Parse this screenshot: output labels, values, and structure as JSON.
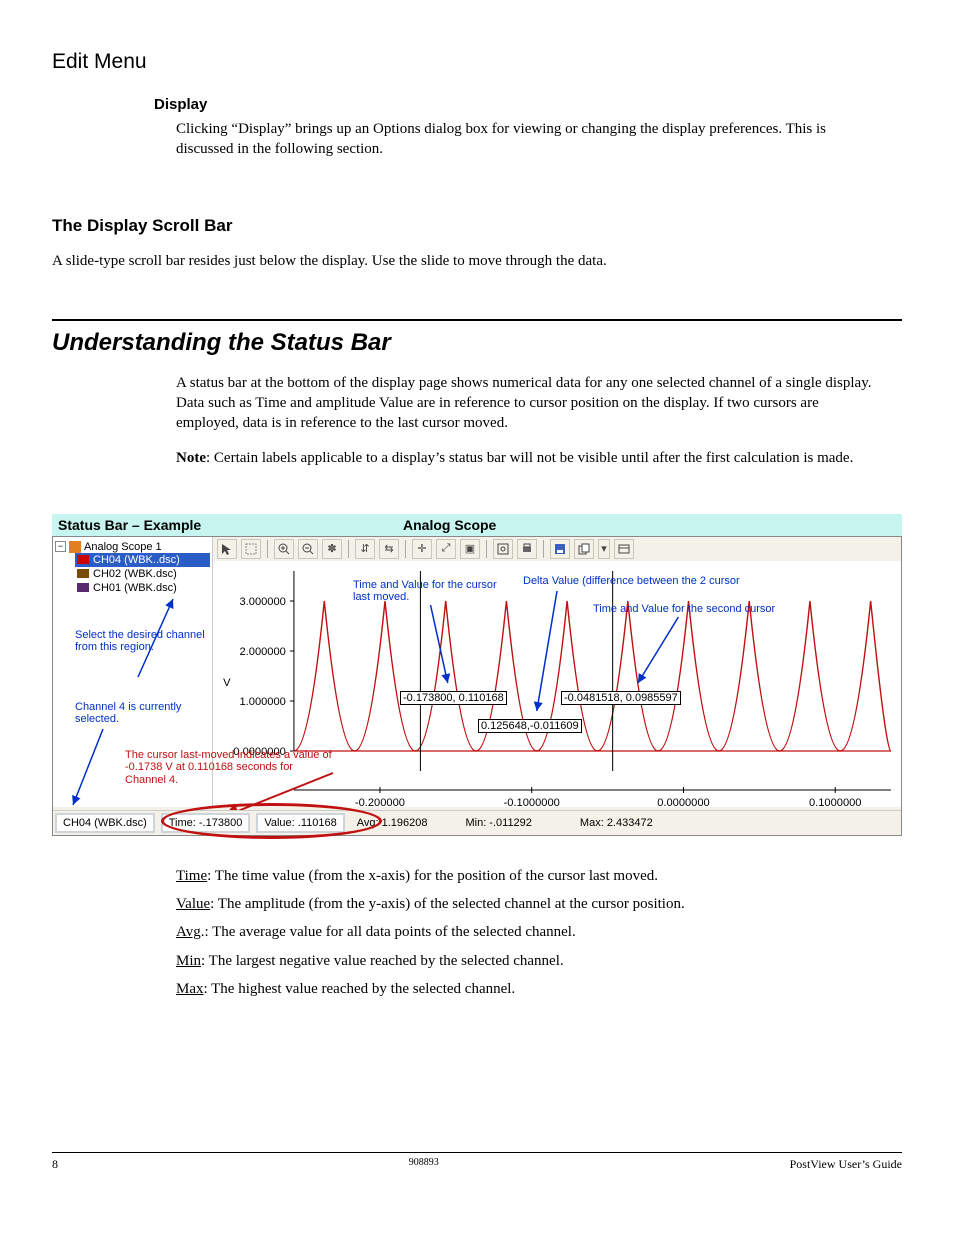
{
  "page_header": "Edit Menu",
  "display_heading": "Display",
  "display_body": "Clicking “Display” brings up an Options dialog box for viewing or changing the display preferences.  This is discussed in the following section.",
  "scroll_heading": "The Display Scroll Bar",
  "scroll_body": "A slide-type scroll bar resides just below the display.   Use the slide to move through the data.",
  "understanding_heading": "Understanding the Status Bar",
  "understanding_p1": "A status bar at the bottom of the display page shows numerical data for any one selected channel of a single display. Data such as Time and amplitude Value are in reference to cursor position on the display.  If two cursors are employed, data is in reference to the last cursor moved.",
  "note_label": "Note",
  "note_body": ":  Certain labels applicable to a display’s status bar will not be visible until after the first calculation is made.",
  "note_body_cont": "made.",
  "fig_header_left": "Status Bar – Example",
  "fig_header_right": "Analog Scope",
  "tree": {
    "root": "Analog Scope 1",
    "items": [
      {
        "label": "CH04 (WBK..dsc)",
        "selected": true,
        "color": "red"
      },
      {
        "label": "CH02 (WBK.dsc)",
        "selected": false,
        "color": "brown"
      },
      {
        "label": "CH01 (WBK.dsc)",
        "selected": false,
        "color": "purple"
      }
    ]
  },
  "toolbar_icons": [
    "pointer-icon",
    "select-rect-icon",
    "zoom-in-icon",
    "zoom-out-icon",
    "snowflake-icon",
    "autoscale-y-icon",
    "autoscale-x-icon",
    "crosshair-icon",
    "home-zoom-icon",
    "fit-icon",
    "preview-icon",
    "print-icon",
    "save-icon",
    "copy-icon",
    "dropdown-icon",
    "properties-icon"
  ],
  "y_ticks": [
    "3.000000",
    "2.000000",
    "1.000000",
    "0.0000000"
  ],
  "x_ticks": [
    "-0.200000",
    "-0.1000000",
    "0.0000000",
    "0.1000000"
  ],
  "callouts": {
    "select_region": "Select the desired channel from this region.",
    "ch4_selected": "Channel 4 is currently selected.",
    "time_value_last": "Time and Value for the cursor last moved.",
    "delta_value": "Delta Value (difference between the 2 cursor",
    "time_value_second": "Time and Value for the second cursor",
    "cursor_explain": "The cursor last-moved indicates a value of  -0.1738 V at 0.110168 seconds for Channel 4."
  },
  "cursor_boxes": {
    "c1": "-0.173800, 0.110168",
    "c2": "-0.0481518, 0.0985597",
    "delta": "0.125648,-0.011609"
  },
  "status": {
    "channel": "CH04 (WBK.dsc)",
    "time": "Time: -.173800",
    "value": "Value: .110168",
    "avg": "Avg: 1.196208",
    "min": "Min: -.011292",
    "max": "Max: 2.433472"
  },
  "defs": {
    "time_label": "Time",
    "time_body": ": The time value (from the x-axis) for the position of the cursor last moved.",
    "value_label": "Value",
    "value_body": ":  The amplitude (from the y-axis) of the selected channel at the cursor position.",
    "avg_label": "Avg",
    "avg_body": ".: The average value for all data points of the selected channel.",
    "min_label": "Min",
    "min_body": ":  The largest negative value reached by the selected channel.",
    "max_label": "Max",
    "max_body": ": The highest value reached by the selected channel."
  },
  "footer": {
    "page": "8",
    "doc_id": "908893",
    "guide": "PostView User’s Guide"
  },
  "chart_data": {
    "type": "line",
    "title": "Analog Scope",
    "xlabel": "",
    "ylabel": "V",
    "xlim": [
      -0.25,
      0.15
    ],
    "ylim": [
      0,
      3
    ],
    "y_ticks": [
      0,
      1,
      2,
      3
    ],
    "x_ticks": [
      -0.2,
      -0.1,
      0.0,
      0.1
    ],
    "series": [
      {
        "name": "CH04 (WBK.dsc)",
        "color": "#c01010",
        "waveform": "periodic ~0.04s period, amplitude ≈ 0 to 2.43 V"
      }
    ],
    "cursors": [
      {
        "x": -0.1738,
        "y": 0.110168
      },
      {
        "x": -0.0481518,
        "y": 0.0985597
      }
    ],
    "cursor_delta": {
      "dx": 0.125648,
      "dy": -0.011609
    },
    "stats": {
      "avg": 1.196208,
      "min": -0.011292,
      "max": 2.433472
    }
  }
}
